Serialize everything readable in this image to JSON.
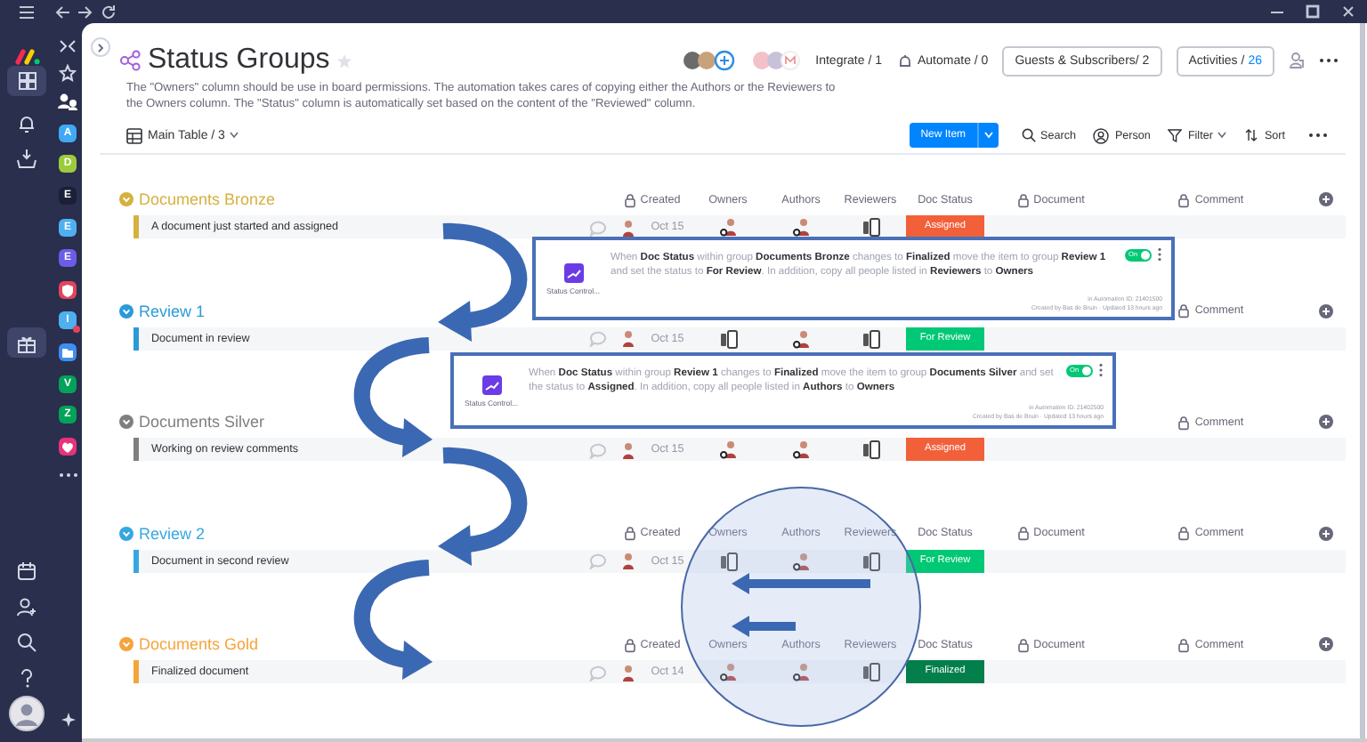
{
  "sidebar": {
    "nav": [
      {
        "kind": "grid",
        "selected": true
      },
      {
        "kind": "bell",
        "selected": false
      },
      {
        "kind": "inbox",
        "selected": false
      },
      {
        "kind": "gift",
        "selected": true
      }
    ]
  },
  "workspaces": [
    {
      "kind": "letter",
      "letter": "A",
      "color": "#3fa9f5",
      "alert": false
    },
    {
      "kind": "letter",
      "letter": "D",
      "color": "#9ccc3b",
      "alert": false
    },
    {
      "kind": "letter",
      "letter": "E",
      "color": "#1c2036",
      "alert": false
    },
    {
      "kind": "letter",
      "letter": "E",
      "color": "#4fb0f0",
      "alert": false
    },
    {
      "kind": "letter",
      "letter": "E",
      "color": "#6c5ce7",
      "alert": false
    },
    {
      "kind": "shield",
      "color": "#e2445c",
      "alert": false
    },
    {
      "kind": "letter",
      "letter": "I",
      "color": "#4fb0f0",
      "alert": true
    },
    {
      "kind": "folder",
      "color": "#3f8ef0",
      "alert": false
    },
    {
      "kind": "letter",
      "letter": "V",
      "color": "#00a359",
      "alert": false
    },
    {
      "kind": "letter",
      "letter": "Z",
      "color": "#00a359",
      "alert": false
    },
    {
      "kind": "heart",
      "color": "#e8337a",
      "alert": false
    }
  ],
  "board": {
    "title": "Status Groups",
    "description": "The \"Owners\" column should be use in board permissions. The automation takes cares of copying either the Authors or the Reviewers to the Owners column. The \"Status\" column is automatically set based on the content of the \"Reviewed\" column.",
    "view": "Main Table / 3",
    "integrate": "Integrate / 1",
    "automate": "Automate / 0",
    "guests": "Guests & Subscribers/ 2",
    "activities": {
      "label": "Activities /",
      "count": "26"
    }
  },
  "toolbar": {
    "new_item": "New Item",
    "search": "Search",
    "person": "Person",
    "filter": "Filter",
    "sort": "Sort"
  },
  "groups": [
    {
      "name": "Documents Bronze",
      "color": "#d6b13f",
      "columns": [
        {
          "kind": "created",
          "label": "Created"
        },
        {
          "kind": "owners",
          "label": "Owners"
        },
        {
          "kind": "authors",
          "label": "Authors"
        },
        {
          "kind": "reviewers",
          "label": "Reviewers"
        },
        {
          "kind": "status",
          "label": "Doc Status"
        },
        {
          "kind": "document",
          "label": "Document"
        },
        {
          "kind": "comment",
          "label": "Comment"
        }
      ],
      "rows": [
        {
          "name": "A document just started and assigned",
          "date": "Oct 15",
          "owners": {
            "kind": "person"
          },
          "authors": {
            "kind": "person"
          },
          "reviewers": {
            "kind": "device"
          },
          "status": {
            "label": "Assigned",
            "color": "#f2603a"
          }
        }
      ]
    },
    {
      "name": "Review 1",
      "color": "#2b9bd8",
      "columns": [
        {
          "kind": "comment",
          "label": "Comment"
        }
      ],
      "rows": [
        {
          "name": "Document in review",
          "date": "Oct 15",
          "owners": {
            "kind": "device"
          },
          "authors": {
            "kind": "person"
          },
          "reviewers": {
            "kind": "device"
          },
          "status": {
            "label": "For Review",
            "color": "#00c875"
          }
        }
      ]
    },
    {
      "name": "Documents Silver",
      "color": "#7f7f7f",
      "columns": [
        {
          "kind": "comment",
          "label": "Comment"
        }
      ],
      "rows": [
        {
          "name": "Working on review comments",
          "date": "Oct 15",
          "owners": {
            "kind": "person"
          },
          "authors": {
            "kind": "person"
          },
          "reviewers": {
            "kind": "device"
          },
          "status": {
            "label": "Assigned",
            "color": "#f2603a"
          }
        }
      ]
    },
    {
      "name": "Review 2",
      "color": "#37a7e0",
      "columns": [
        {
          "kind": "created",
          "label": "Created"
        },
        {
          "kind": "owners",
          "label": "Owners"
        },
        {
          "kind": "authors",
          "label": "Authors"
        },
        {
          "kind": "reviewers",
          "label": "Reviewers"
        },
        {
          "kind": "status",
          "label": "Doc Status"
        },
        {
          "kind": "document",
          "label": "Document"
        },
        {
          "kind": "comment",
          "label": "Comment"
        }
      ],
      "rows": [
        {
          "name": "Document in second review",
          "date": "Oct 15",
          "owners": {
            "kind": "device"
          },
          "authors": {
            "kind": "person"
          },
          "reviewers": {
            "kind": "device"
          },
          "status": {
            "label": "For Review",
            "color": "#00c875"
          }
        }
      ]
    },
    {
      "name": "Documents Gold",
      "color": "#f5a43a",
      "columns": [
        {
          "kind": "created",
          "label": "Created"
        },
        {
          "kind": "owners",
          "label": "Owners"
        },
        {
          "kind": "authors",
          "label": "Authors"
        },
        {
          "kind": "reviewers",
          "label": "Reviewers"
        },
        {
          "kind": "status",
          "label": "Doc Status"
        },
        {
          "kind": "document",
          "label": "Document"
        },
        {
          "kind": "comment",
          "label": "Comment"
        }
      ],
      "rows": [
        {
          "name": "Finalized document",
          "date": "Oct 14",
          "owners": {
            "kind": "person"
          },
          "authors": {
            "kind": "person"
          },
          "reviewers": {
            "kind": "device"
          },
          "status": {
            "label": "Finalized",
            "color": "#037f4c"
          }
        }
      ]
    }
  ],
  "automations": [
    {
      "app": "Status Control...",
      "text": "When **Doc Status** within group **Documents Bronze** changes to **Finalized** move the item to group **Review 1** and set the status to **For Review**. In addition, copy all people listed in **Reviewers** to **Owners**",
      "on": true,
      "toggle_label": "On",
      "meta": [
        "in Automation ID: 21401500",
        "Created by Bas de Bruin · Updated 13 hours ago"
      ]
    },
    {
      "app": "Status Control...",
      "text": "When **Doc Status** within group **Review 1** changes to **Finalized** move the item to group **Documents Silver** and set the status to **Assigned**. In addition, copy all people listed in **Authors** to **Owners**",
      "on": true,
      "toggle_label": "On",
      "meta": [
        "in Automation ID: 21402500",
        "Created by Bas de Bruin · Updated 13 hours ago"
      ]
    }
  ]
}
